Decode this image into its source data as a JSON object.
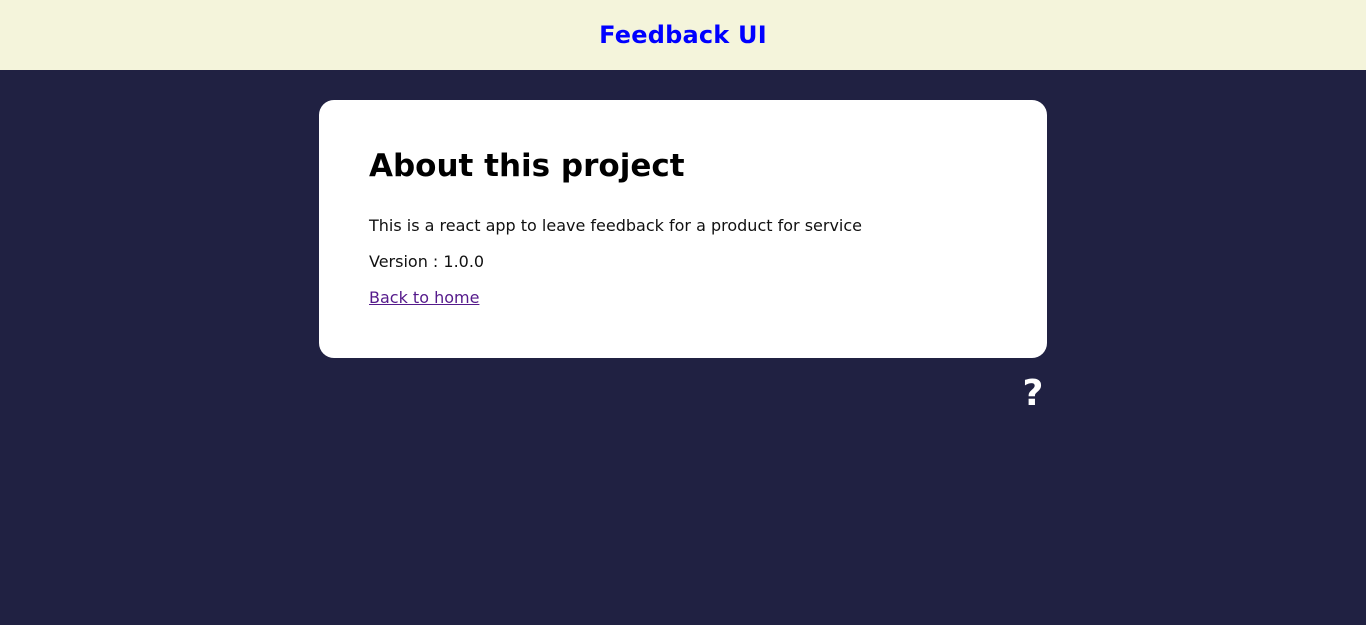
{
  "header": {
    "title": "Feedback UI"
  },
  "about": {
    "heading": "About this project",
    "description": "This is a react app to leave feedback for a product for service",
    "version": "Version : 1.0.0",
    "back_link": "Back to home"
  },
  "icons": {
    "about_link_icon": "question-icon",
    "about_link_glyph": "?"
  },
  "colors": {
    "page_background": "#202142",
    "header_background": "#f4f4db",
    "header_text": "#0000ff",
    "card_background": "#ffffff",
    "link": "#551a8b"
  }
}
